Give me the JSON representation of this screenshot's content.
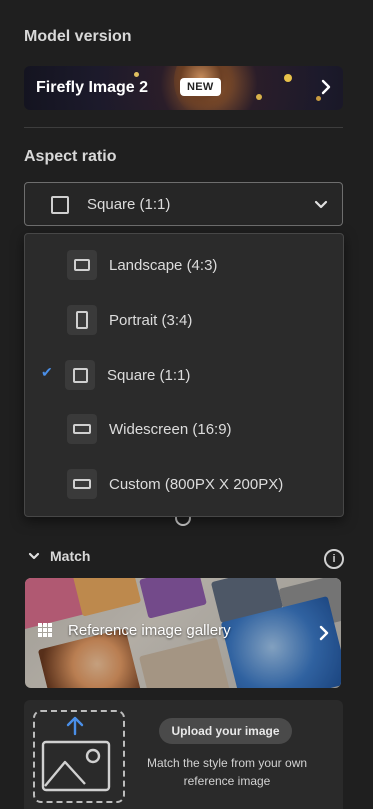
{
  "model": {
    "section_title": "Model version",
    "name": "Firefly Image 2",
    "badge": "NEW"
  },
  "aspect": {
    "section_title": "Aspect ratio",
    "selected": "Square (1:1)",
    "options": [
      {
        "label": "Landscape (4:3)",
        "icon": "landscape-ratio-icon",
        "selected": false
      },
      {
        "label": "Portrait (3:4)",
        "icon": "portrait-ratio-icon",
        "selected": false
      },
      {
        "label": "Square (1:1)",
        "icon": "square-ratio-icon",
        "selected": true
      },
      {
        "label": "Widescreen (16:9)",
        "icon": "widescreen-ratio-icon",
        "selected": false
      },
      {
        "label": "Custom (800PX X 200PX)",
        "icon": "custom-ratio-icon",
        "selected": false
      }
    ]
  },
  "match": {
    "section_title": "Match",
    "gallery_label": "Reference image gallery",
    "upload_button": "Upload your image",
    "upload_description": "Match the style from your own reference image"
  },
  "colors": {
    "background": "#1f1f1f",
    "accent_check": "#4a8fe8"
  }
}
